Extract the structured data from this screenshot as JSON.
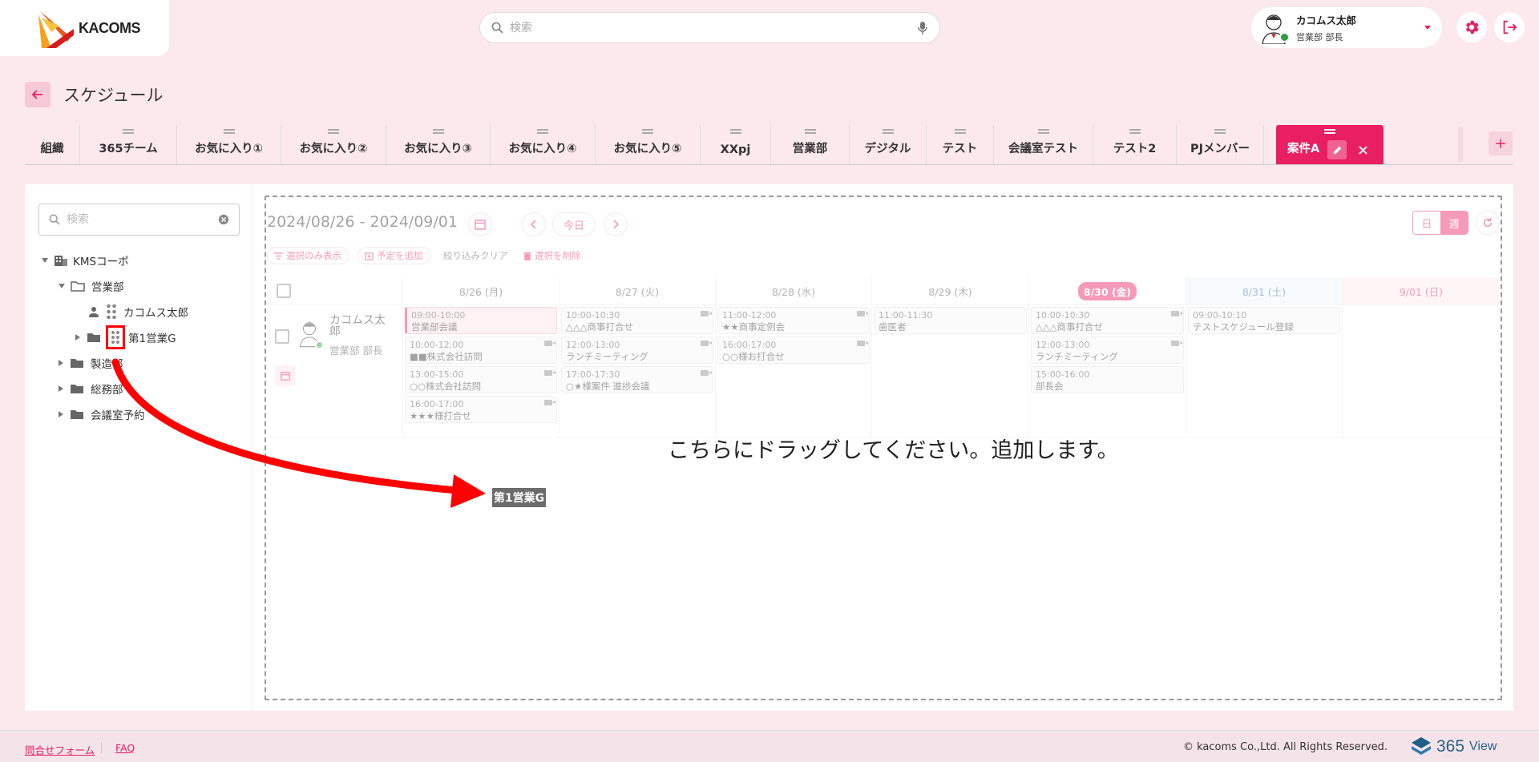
{
  "header": {
    "logo_text": "KACOMS",
    "search_placeholder": "検索",
    "user_name": "カコムス太郎",
    "user_role": "営業部 部長"
  },
  "page": {
    "title": "スケジュール"
  },
  "tabs": [
    {
      "label": "組織"
    },
    {
      "label": "365チーム"
    },
    {
      "label": "お気に入り①"
    },
    {
      "label": "お気に入り②"
    },
    {
      "label": "お気に入り③"
    },
    {
      "label": "お気に入り④"
    },
    {
      "label": "お気に入り⑤"
    },
    {
      "label": "XXpj"
    },
    {
      "label": "営業部"
    },
    {
      "label": "デジタル"
    },
    {
      "label": "テスト"
    },
    {
      "label": "会議室テスト"
    },
    {
      "label": "テスト2"
    },
    {
      "label": "PJメンバー"
    },
    {
      "label": "案件A"
    }
  ],
  "tree": {
    "search_placeholder": "検索",
    "root": "KMSコーポ",
    "dept_sales": "営業部",
    "user": "カコムス太郎",
    "group": "第1営業G",
    "dept_mfg": "製造部",
    "dept_general": "総務部",
    "meeting_rooms": "会議室予約"
  },
  "calendar": {
    "range": "2024/08/26 - 2024/09/01",
    "today_label": "今日",
    "view_day": "日",
    "view_week": "週",
    "actions": {
      "show_selected": "選択のみ表示",
      "add_event": "予定を追加",
      "clear_filter": "絞り込みクリア",
      "delete_selected": "選択を削除"
    },
    "days": [
      {
        "label": "8/26 (月)"
      },
      {
        "label": "8/27 (火)"
      },
      {
        "label": "8/28 (水)"
      },
      {
        "label": "8/29 (木)"
      },
      {
        "label": "8/30 (金)"
      },
      {
        "label": "8/31 (土)"
      },
      {
        "label": "9/01 (日)"
      }
    ],
    "member": {
      "name_line1": "カコムス太",
      "name_line2": "郎",
      "role": "営業部 部長"
    },
    "events": {
      "d0": [
        {
          "time": "09:00-10:00",
          "title": "営業部会議"
        },
        {
          "time": "10:00-12:00",
          "title": "■■株式会社訪問"
        },
        {
          "time": "13:00-15:00",
          "title": "○○株式会社訪問"
        },
        {
          "time": "16:00-17:00",
          "title": "★★★様打合せ"
        }
      ],
      "d1": [
        {
          "time": "10:00-10:30",
          "title": "△△△商事打合せ"
        },
        {
          "time": "12:00-13:00",
          "title": "ランチミーティング"
        },
        {
          "time": "17:00-17:30",
          "title": "○★様案件 進捗会議"
        }
      ],
      "d2": [
        {
          "time": "11:00-12:00",
          "title": "★★商事定例会"
        },
        {
          "time": "16:00-17:00",
          "title": "○○様お打合せ"
        }
      ],
      "d3": [
        {
          "time": "11:00-11:30",
          "title": "歯医者"
        }
      ],
      "d4": [
        {
          "time": "10:00-10:30",
          "title": "△△△商事打合せ"
        },
        {
          "time": "12:00-13:00",
          "title": "ランチミーティング"
        },
        {
          "time": "15:00-16:00",
          "title": "部長会"
        }
      ],
      "d5": [
        {
          "time": "09:00-10:10",
          "title": "テストスケジュール登録"
        }
      ]
    },
    "drop_hint": "こちらにドラッグしてください。追加します。",
    "drag_ghost": "第1営業G"
  },
  "footer": {
    "contact": "問合せフォーム",
    "faq": "FAQ",
    "copyright": "© kacoms Co.,Ltd. All Rights Reserved.",
    "brand_num": "365",
    "brand_word": "View"
  },
  "colors": {
    "accent": "#e91e63",
    "background": "#fbe9ee",
    "annotation": "#ff0000"
  }
}
